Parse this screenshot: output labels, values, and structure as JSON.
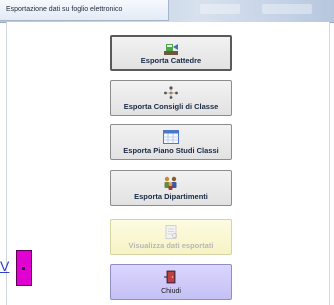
{
  "window": {
    "title": "Esportazione dati su foglio elettronico"
  },
  "buttons": {
    "cattedre": {
      "label": "Esporta Cattedre",
      "icon": "export-chair-icon"
    },
    "consigli": {
      "label": "Esporta Consigli di Classe",
      "icon": "people-group-icon"
    },
    "piano": {
      "label": "Esporta Piano Studi Classi",
      "icon": "calendar-grid-icon"
    },
    "dipartimenti": {
      "label": "Esporta Dipartimenti",
      "icon": "team-icon"
    },
    "visualizza": {
      "label": "Visualizza dati esportati",
      "icon": "document-view-icon",
      "disabled": true
    },
    "chiudi": {
      "label": "Chiudi",
      "icon": "exit-door-icon"
    }
  },
  "side_fragment": {
    "text": "V"
  },
  "colors": {
    "visualizza_bg": "#f7f3c6",
    "chiudi_bg": "#c5c0f4",
    "magenta_block": "#e000d2",
    "label_text": "#1a2a44"
  }
}
